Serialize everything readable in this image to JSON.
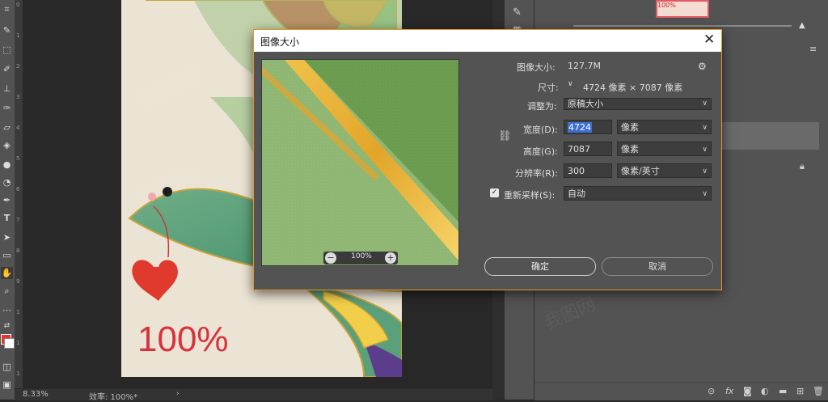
{
  "dialog": {
    "title": "图像大小",
    "image_size_label": "图像大小:",
    "image_size_value": "127.7M",
    "dimensions_label": "尺寸:",
    "dimensions_value": "4724 像素 × 7087 像素",
    "fit_to_label": "调整为:",
    "fit_to_value": "原稿大小",
    "width_label": "宽度(D):",
    "width_value": "4724",
    "width_unit": "像素",
    "height_label": "高度(G):",
    "height_value": "7087",
    "height_unit": "像素",
    "resolution_label": "分辨率(R):",
    "resolution_value": "300",
    "resolution_unit": "像素/英寸",
    "resample_label": "重新采样(S):",
    "resample_checked": true,
    "resample_value": "自动",
    "preview_zoom": "100%",
    "ok_label": "确定",
    "cancel_label": "取消"
  },
  "canvas": {
    "overlay_zoom_text": "100%"
  },
  "statusbar": {
    "zoom": "8.33%",
    "efficiency": "效率: 100%*"
  },
  "layers": {
    "thumb_text": "100%"
  },
  "watermark": "我图网",
  "ruler_numbers": [
    "0",
    "1",
    "2",
    "3",
    "4",
    "5",
    "6",
    "7",
    "8",
    "9",
    "1",
    "1",
    "1"
  ],
  "colors": {
    "accent_orange": "#e4962c",
    "fg_color": "#e8322e",
    "selection_blue": "#3d6ed0"
  }
}
